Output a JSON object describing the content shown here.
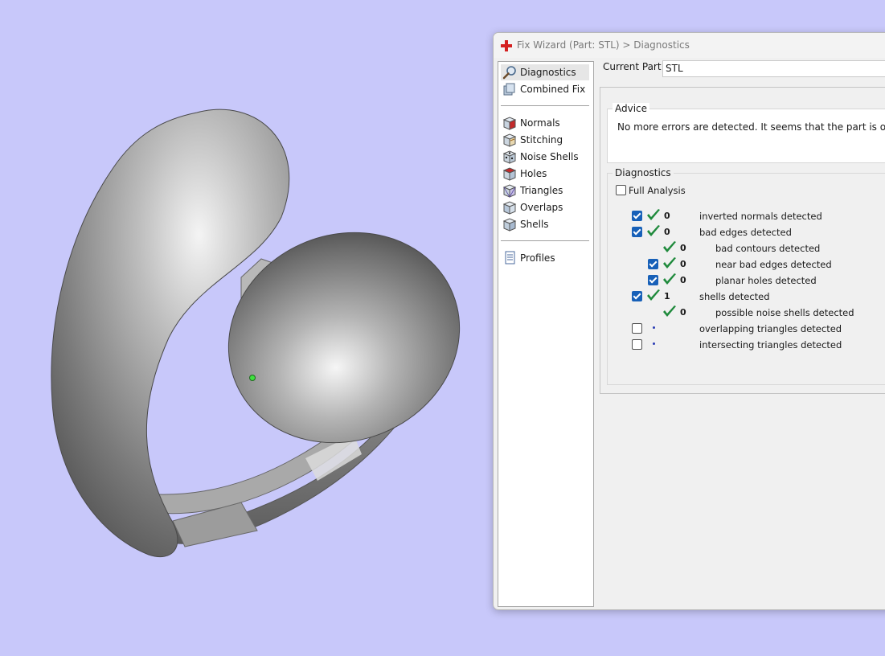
{
  "window": {
    "title": "Fix Wizard (Part: STL) > Diagnostics"
  },
  "nav": {
    "items": [
      {
        "label": "Diagnostics",
        "icon": "magnifier-icon"
      },
      {
        "label": "Combined Fix",
        "icon": "cube-stack-icon"
      },
      {
        "label": "Normals",
        "icon": "cube-normals-icon"
      },
      {
        "label": "Stitching",
        "icon": "cube-stitching-icon"
      },
      {
        "label": "Noise Shells",
        "icon": "cube-noise-icon"
      },
      {
        "label": "Holes",
        "icon": "cube-holes-icon"
      },
      {
        "label": "Triangles",
        "icon": "cube-triangles-icon"
      },
      {
        "label": "Overlaps",
        "icon": "cube-overlaps-icon"
      },
      {
        "label": "Shells",
        "icon": "cube-shells-icon"
      },
      {
        "label": "Profiles",
        "icon": "document-icon"
      }
    ],
    "active": "Diagnostics"
  },
  "current_part": {
    "label": "Current Part:",
    "value": "STL"
  },
  "advice": {
    "title": "Advice",
    "text": "No more errors are detected. It seems that the part is ok. Note that n"
  },
  "diagnostics": {
    "title": "Diagnostics",
    "full_analysis": {
      "label": "Full Analysis",
      "checked": false
    },
    "rows": [
      {
        "checkbox": true,
        "checked": true,
        "status": "ok",
        "count": "0",
        "label": "inverted normals detected",
        "indent": 0
      },
      {
        "checkbox": true,
        "checked": true,
        "status": "ok",
        "count": "0",
        "label": "bad edges detected",
        "indent": 0
      },
      {
        "checkbox": false,
        "checked": false,
        "status": "ok",
        "count": "0",
        "label": "bad contours detected",
        "indent": 1
      },
      {
        "checkbox": true,
        "checked": true,
        "status": "ok",
        "count": "0",
        "label": "near bad edges detected",
        "indent": 1
      },
      {
        "checkbox": true,
        "checked": true,
        "status": "ok",
        "count": "0",
        "label": "planar holes detected",
        "indent": 1
      },
      {
        "checkbox": true,
        "checked": true,
        "status": "ok",
        "count": "1",
        "label": "shells detected",
        "indent": 0
      },
      {
        "checkbox": false,
        "checked": false,
        "status": "ok",
        "count": "0",
        "label": "possible noise shells detected",
        "indent": 1
      },
      {
        "checkbox": true,
        "checked": false,
        "status": "pending",
        "count": "",
        "label": "overlapping triangles detected",
        "indent": 0
      },
      {
        "checkbox": true,
        "checked": false,
        "status": "pending",
        "count": "",
        "label": "intersecting triangles detected",
        "indent": 0
      }
    ]
  },
  "colors": {
    "viewport_background": "#c8c8fa",
    "check_green": "#1f8a3c",
    "checkbox_blue": "#1760b8",
    "model_gray": "#8a8a8a",
    "selection_point": "#3fe03f"
  }
}
